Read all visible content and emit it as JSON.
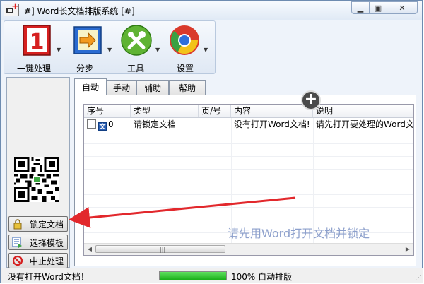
{
  "window": {
    "title": "#] Word长文档排版系统 [#]"
  },
  "toolbar": {
    "items": [
      {
        "label": "一键处理",
        "icon": "red-number-one-icon"
      },
      {
        "label": "分步",
        "icon": "step-arrow-icon"
      },
      {
        "label": "工具",
        "icon": "tools-icon"
      },
      {
        "label": "设置",
        "icon": "chrome-style-settings-icon"
      }
    ]
  },
  "side_buttons": {
    "lock": "锁定文档",
    "template": "选择模板",
    "stop": "中止处理"
  },
  "tabs": [
    {
      "label": "自动",
      "active": true
    },
    {
      "label": "手动",
      "active": false
    },
    {
      "label": "辅助",
      "active": false
    },
    {
      "label": "帮助",
      "active": false
    }
  ],
  "table": {
    "columns": [
      "序号",
      "类型",
      "页/号",
      "内容",
      "说明"
    ],
    "rows": [
      {
        "index": "0",
        "type": "请锁定文档",
        "page": "",
        "content": "没有打开Word文档!",
        "note": "请先打开要处理的Word文档"
      }
    ]
  },
  "watermark": "请先用Word打开文档并锁定",
  "status": {
    "message": "没有打开Word文档！",
    "progress": 100,
    "progress_text": "100% 自动排版"
  },
  "colors": {
    "accent_blue": "#2b5fb3",
    "arrow_red": "#e2282c",
    "progress_green": "#19b019"
  }
}
